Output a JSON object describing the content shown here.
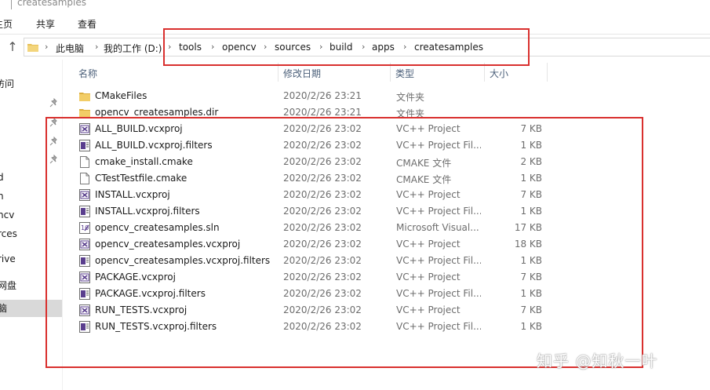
{
  "window": {
    "title": "createsamples"
  },
  "ribbon": {
    "tabs": [
      "主页",
      "共享",
      "查看"
    ]
  },
  "address": {
    "crumbs": [
      "此电脑",
      "我的工作 (D:)",
      "tools",
      "opencv",
      "sources",
      "build",
      "apps",
      "createsamples"
    ]
  },
  "nav": {
    "items": [
      "访问",
      "d",
      "n",
      "ncv",
      "rces",
      "rive",
      "网盘",
      "脑"
    ]
  },
  "columns": {
    "name": "名称",
    "date": "修改日期",
    "type": "类型",
    "size": "大小"
  },
  "files": [
    {
      "name": "CMakeFiles",
      "date": "2020/2/26 23:21",
      "type": "文件夹",
      "size": "",
      "icon": "folder-icon"
    },
    {
      "name": "opencv_createsamples.dir",
      "date": "2020/2/26 23:21",
      "type": "文件夹",
      "size": "",
      "icon": "folder-icon"
    },
    {
      "name": "ALL_BUILD.vcxproj",
      "date": "2020/2/26 23:02",
      "type": "VC++ Project",
      "size": "7 KB",
      "icon": "vcxproj-icon"
    },
    {
      "name": "ALL_BUILD.vcxproj.filters",
      "date": "2020/2/26 23:02",
      "type": "VC++ Project Fil...",
      "size": "1 KB",
      "icon": "filters-icon"
    },
    {
      "name": "cmake_install.cmake",
      "date": "2020/2/26 23:02",
      "type": "CMAKE 文件",
      "size": "2 KB",
      "icon": "blank-file-icon"
    },
    {
      "name": "CTestTestfile.cmake",
      "date": "2020/2/26 23:02",
      "type": "CMAKE 文件",
      "size": "1 KB",
      "icon": "blank-file-icon"
    },
    {
      "name": "INSTALL.vcxproj",
      "date": "2020/2/26 23:02",
      "type": "VC++ Project",
      "size": "7 KB",
      "icon": "vcxproj-icon"
    },
    {
      "name": "INSTALL.vcxproj.filters",
      "date": "2020/2/26 23:02",
      "type": "VC++ Project Fil...",
      "size": "1 KB",
      "icon": "filters-icon"
    },
    {
      "name": "opencv_createsamples.sln",
      "date": "2020/2/26 23:02",
      "type": "Microsoft Visual...",
      "size": "17 KB",
      "icon": "sln-icon"
    },
    {
      "name": "opencv_createsamples.vcxproj",
      "date": "2020/2/26 23:02",
      "type": "VC++ Project",
      "size": "18 KB",
      "icon": "vcxproj-icon"
    },
    {
      "name": "opencv_createsamples.vcxproj.filters",
      "date": "2020/2/26 23:02",
      "type": "VC++ Project Fil...",
      "size": "1 KB",
      "icon": "filters-icon"
    },
    {
      "name": "PACKAGE.vcxproj",
      "date": "2020/2/26 23:02",
      "type": "VC++ Project",
      "size": "7 KB",
      "icon": "vcxproj-icon"
    },
    {
      "name": "PACKAGE.vcxproj.filters",
      "date": "2020/2/26 23:02",
      "type": "VC++ Project Fil...",
      "size": "1 KB",
      "icon": "filters-icon"
    },
    {
      "name": "RUN_TESTS.vcxproj",
      "date": "2020/2/26 23:02",
      "type": "VC++ Project",
      "size": "7 KB",
      "icon": "vcxproj-icon"
    },
    {
      "name": "RUN_TESTS.vcxproj.filters",
      "date": "2020/2/26 23:02",
      "type": "VC++ Project Fil...",
      "size": "1 KB",
      "icon": "filters-icon"
    }
  ],
  "watermark": "知乎 @知秋一叶",
  "colors": {
    "annotation": "#d9302e",
    "folder": "#e8c15a",
    "header_text": "#4c607a"
  }
}
